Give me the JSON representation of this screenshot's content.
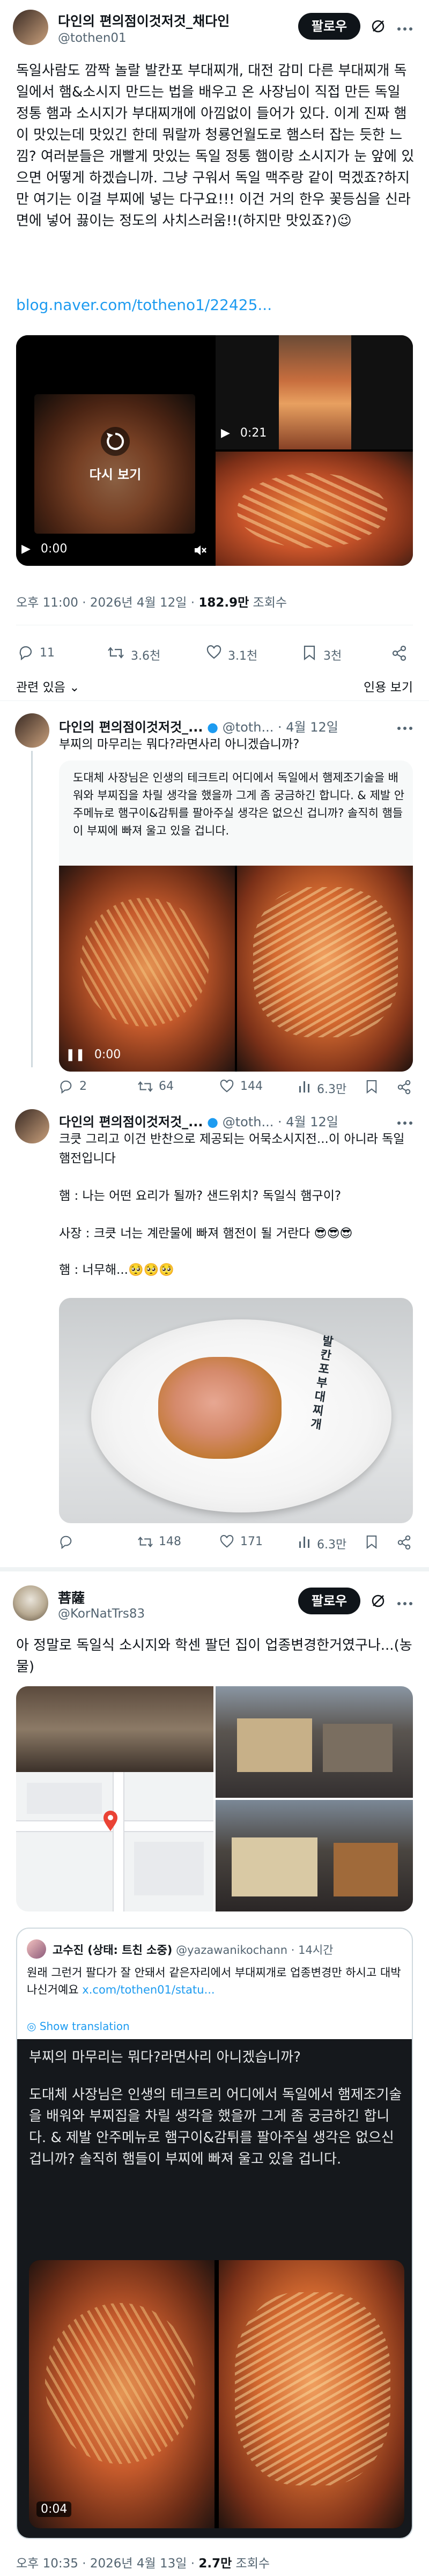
{
  "main_post": {
    "author_name": "다인의 편의점이것저것_채다인",
    "handle": "@tothen01",
    "follow_label": "팔로우",
    "text": "독일사람도 깜짝 놀랄 발칸포 부대찌개, 대전 감미 다른 부대찌개 독일에서 햄&소시지 만드는 법을 배우고 온 사장님이 직접 만든 독일 정통 햄과 소시지가 부대찌개에 아낌없이 들어가 있다. 이게 진짜 햄이 맛있는데 맛있긴 한데 뭐랄까 청룡언월도로 햄스터 잡는 듯한 느낌? 여러분들은 개빨게 맛있는 독일 정통 햄이랑 소시지가 눈 앞에 있으면 어떻게 하겠습니까. 그냥 구워서 독일 맥주랑 같이 먹겠죠?하지만 여기는 이걸 부찌에 넣는 다구요!!! 이건 거의 한우 꽃등심을 신라면에 넣어 끓이는 정도의 사치스러움!!(하지만 맛있죠?)",
    "emoji_smile": "😉",
    "link": "blog.naver.com/totheno1/22425...",
    "replay_label": "다시 보기",
    "video1_time": "0:00",
    "video2_time": "0:21",
    "meta_time": "오후 11:00 · 2026년 4월 12일 · ",
    "meta_views": "182.9만",
    "meta_views_suffix": " 조회수",
    "actions": {
      "replies": "11",
      "retweets": "3.6천",
      "likes": "3.1천",
      "bookmarks": "3천"
    },
    "sort_label": "관련 있음",
    "quote_sort_label": "인용 보기"
  },
  "reply1": {
    "author_name": "다인의 편의점이것저것_...",
    "handle": "@toth...",
    "date": "· 4월 12일",
    "line1": "부찌의 마무리는 뭐다?라면사리 아니겠습니까?",
    "card_text": "도대체 사장님은 인생의 테크트리 어디에서 독일에서 햄제조기술을 배워와 부찌집을 차릴 생각을 했을까 그게 좀 궁금하긴 합니다. & 제발 안주메뉴로 햄구이&감튀를 팔아주실 생각은 없으신 겁니까? 솔직히 햄들이 부찌에 빠져 울고 있을 겁니다.",
    "video_time": "0:00",
    "actions": {
      "replies": "2",
      "retweets": "64",
      "likes": "144",
      "views": "6.3만"
    }
  },
  "reply2": {
    "author_name": "다인의 편의점이것저것_...",
    "handle": "@toth...",
    "date": "· 4월 12일",
    "line1": "크큿 그리고 이건 반찬으로 제공되는 어묵소시지전...이 아니라 독일햄전입니다",
    "line2": "햄 : 나는 어떤 요리가 될까? 샌드위치? 독일식 햄구이?",
    "line3": "사장 : 크큿 너는 계란물에 빠져 햄전이 될 거란다 😎😎😎",
    "line4": "햄 : 너무해...🥺🥺🥺",
    "plate_text": "발칸포부대찌개",
    "actions": {
      "replies": "",
      "retweets": "148",
      "likes": "171",
      "views": "6.3만"
    }
  },
  "post3": {
    "author_name": "菩薩",
    "handle": "@KorNatTrs83",
    "follow_label": "팔로우",
    "text": "아 정말로 독일식 소시지와 학센 팔던 집이 업종변경한거였구나...(농물)",
    "quote": {
      "author_name": "고수진 (상태: 트친 소중)",
      "handle": "@yazawanikochann",
      "time": "· 14시간",
      "text": "원래 그런거 팔다가 잘 안돼서 같은자리에서 부대찌개로 업종변경만 하시고 대박나신거예요",
      "link": "x.com/tothen01/statu...",
      "translation_label": "Show translation"
    },
    "inner_quote": {
      "text": "부찌의 마무리는 뭐다?라면사리 아니겠습니까?",
      "text2": "도대체 사장님은 인생의 테크트리 어디에서 독일에서 햄제조기술을 배워와 부찌집을 차릴 생각을 했을까 그게 좀 궁금하긴 합니다. & 제발 안주메뉴로 햄구이&감튀를 팔아주실 생각은 없으신 겁니까? 솔직히 햄들이 부찌에 빠져 울고 있을 겁니다.",
      "video_time": "0:04"
    },
    "meta_time": "오후 10:35 · 2026년 4월 13일 · ",
    "meta_views": "2.7만",
    "meta_views_suffix": " 조회수"
  },
  "colors": {
    "accent": "#1d9bf0",
    "text": "#0f1419",
    "secondary": "#536471",
    "border": "#cfd9de"
  }
}
